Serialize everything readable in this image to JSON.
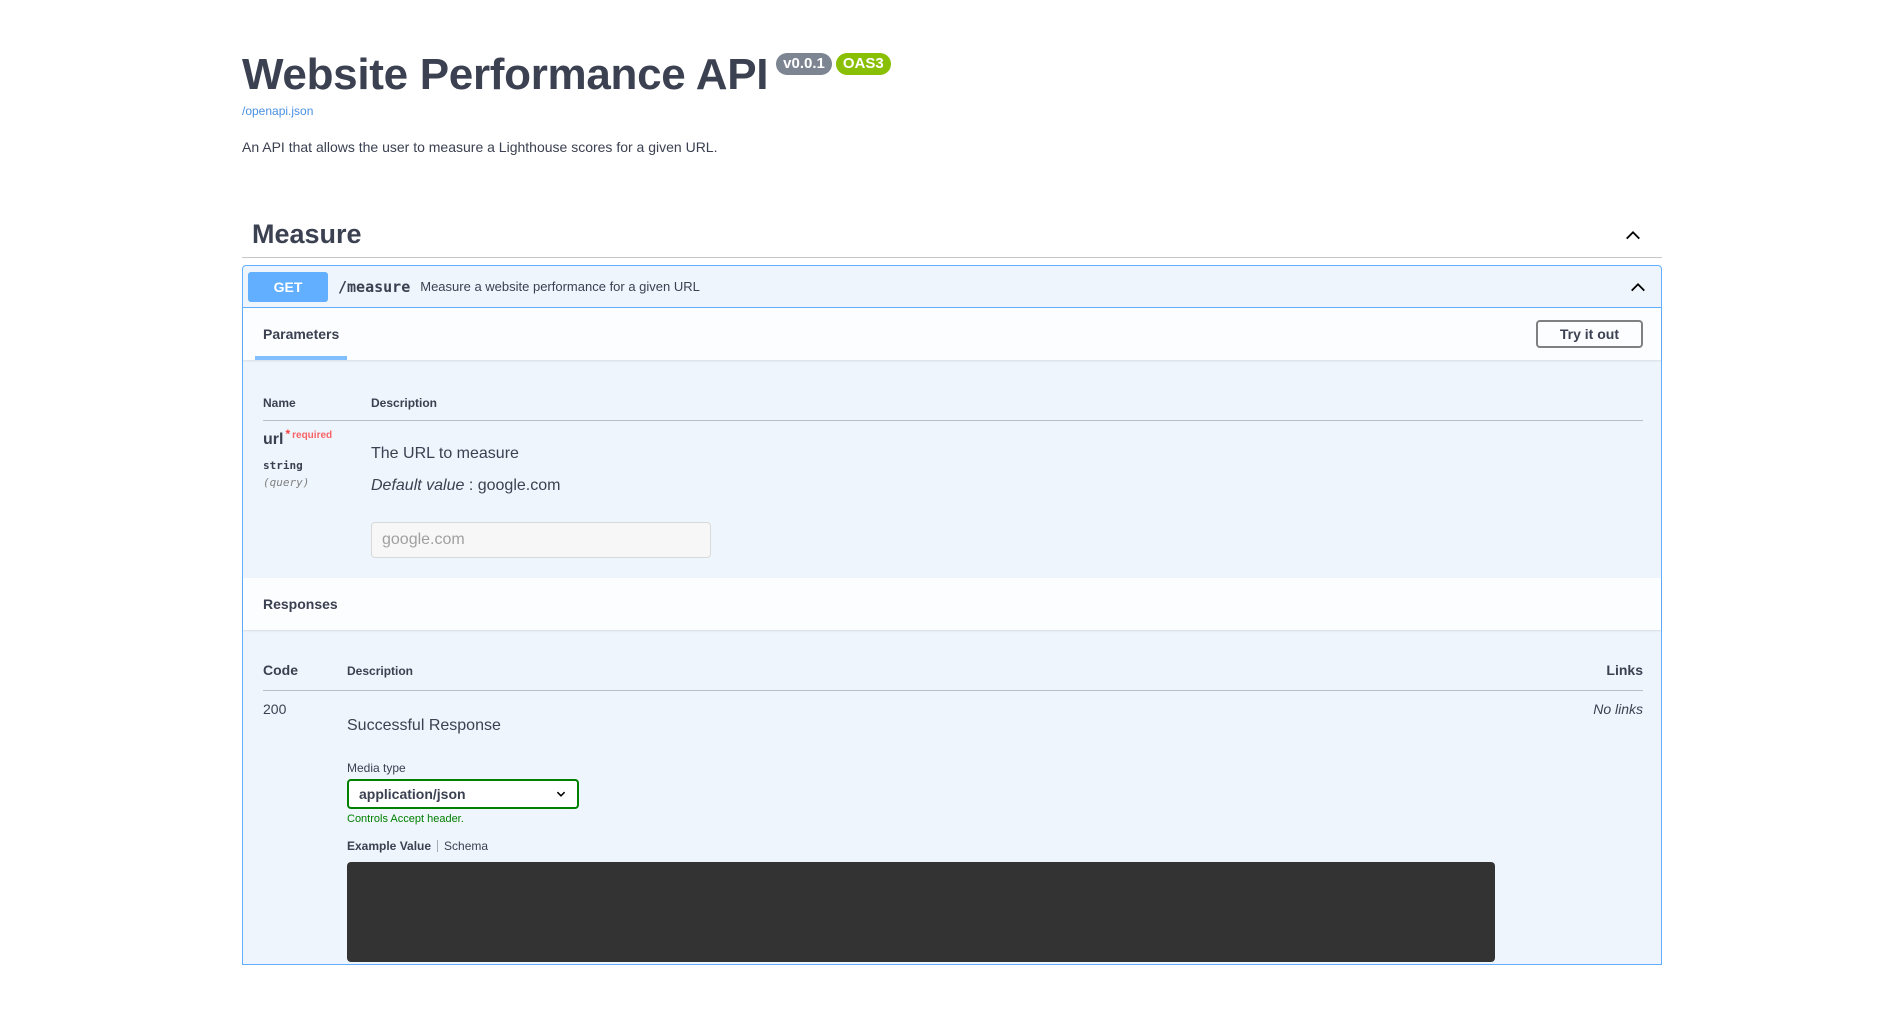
{
  "info": {
    "title": "Website Performance API",
    "version": "v0.0.1",
    "oas": "OAS3",
    "spec_link": "/openapi.json",
    "description": "An API that allows the user to measure a Lighthouse scores for a given URL."
  },
  "tag": {
    "name": "Measure",
    "chevron_icon": "chevron-up-icon"
  },
  "operation": {
    "method": "GET",
    "path": "/measure",
    "summary": "Measure a website performance for a given URL",
    "parameters_tab": "Parameters",
    "try_button": "Try it out",
    "table_headers": {
      "name": "Name",
      "description": "Description"
    },
    "parameter": {
      "name": "url",
      "required_star": "*",
      "required_label": "required",
      "type": "string",
      "in": "(query)",
      "description": "The URL to measure",
      "default_label": "Default value",
      "default_sep": " : ",
      "default_value": "google.com",
      "placeholder": "google.com"
    }
  },
  "responses": {
    "title": "Responses",
    "headers": {
      "code": "Code",
      "description": "Description",
      "links": "Links"
    },
    "rows": [
      {
        "code": "200",
        "description": "Successful Response",
        "links": "No links",
        "media_type_label": "Media type",
        "media_type": "application/json",
        "controls": "Controls Accept header.",
        "example_tab": "Example Value",
        "schema_tab": "Schema"
      }
    ]
  },
  "colors": {
    "get_accent": "#61affe",
    "oas_badge": "#89bf04",
    "version_badge": "#7d8492",
    "required": "#f93e3e",
    "select_border": "#008000"
  }
}
